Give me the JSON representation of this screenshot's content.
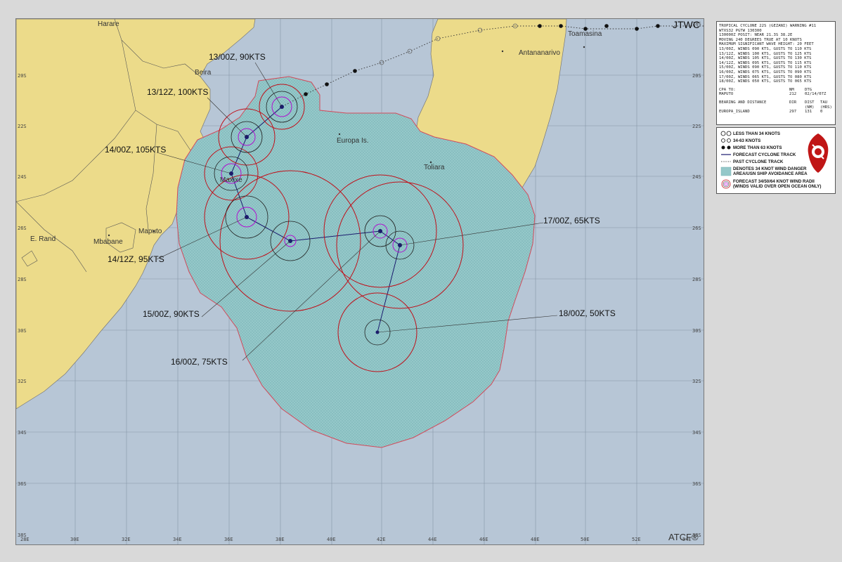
{
  "header": {
    "agency": "JTWC",
    "footer": "ATCF®"
  },
  "axes": {
    "lon_labels": [
      "28E",
      "30E",
      "32E",
      "34E",
      "36E",
      "38E",
      "40E",
      "42E",
      "44E",
      "46E",
      "48E",
      "50E",
      "52E",
      "54E"
    ],
    "lat_labels": [
      "18S",
      "20S",
      "22S",
      "24S",
      "26S",
      "28S",
      "30S",
      "32S",
      "34S",
      "36S",
      "38S"
    ]
  },
  "places": [
    {
      "name": "Harare"
    },
    {
      "name": "Beira"
    },
    {
      "name": "Antananarivo"
    },
    {
      "name": "Toamasina"
    },
    {
      "name": "Europa Is."
    },
    {
      "name": "Toliara"
    },
    {
      "name": "Maxixe"
    },
    {
      "name": "Maputo"
    },
    {
      "name": "Mbabane"
    },
    {
      "name": "E. Rand"
    }
  ],
  "forecast_labels": [
    {
      "text": "13/00Z,  90KTS"
    },
    {
      "text": "13/12Z, 100KTS"
    },
    {
      "text": "14/00Z, 105KTS"
    },
    {
      "text": "14/12Z,  95KTS"
    },
    {
      "text": "15/00Z, 90KTS"
    },
    {
      "text": "16/00Z,  75KTS"
    },
    {
      "text": "17/00Z,  65KTS"
    },
    {
      "text": "18/00Z,  50KTS"
    }
  ],
  "info": {
    "lines": [
      "TROPICAL CYCLONE 22S (GEZANI) WARNING #11",
      "WTXS32 PGTW 130300",
      "130000Z POSIT: NEAR 21.3S 38.2E",
      "MOVING 240 DEGREES TRUE AT 10 KNOTS",
      "MAXIMUM SIGNIFICANT WAVE HEIGHT: 20 FEET",
      "13/00Z, WINDS 090 KTS, GUSTS TO 110 KTS",
      "13/12Z, WINDS 100 KTS, GUSTS TO 125 KTS",
      "14/00Z, WINDS 105 KTS, GUSTS TO 130 KTS",
      "14/12Z, WINDS 095 KTS, GUSTS TO 115 KTS",
      "15/00Z, WINDS 090 KTS, GUSTS TO 110 KTS",
      "16/00Z, WINDS 075 KTS, GUSTS TO 090 KTS",
      "17/00Z, WINDS 065 KTS, GUSTS TO 080 KTS",
      "18/00Z, WINDS 050 KTS, GUSTS TO 065 KTS"
    ],
    "cpa_header": [
      "CPA TO:",
      "NM",
      "DTG"
    ],
    "cpa_row": [
      "MAPUTO",
      "212",
      "02/14/07Z"
    ],
    "bearing_header": [
      "BEARING AND DISTANCE",
      "DIR",
      "DIST",
      "TAU"
    ],
    "bearing_units": [
      "",
      "",
      "(NM)",
      "(HRS)"
    ],
    "bearing_row": [
      "EUROPA_ISLAND",
      "297",
      "131",
      "0"
    ]
  },
  "legend": [
    {
      "label": "LESS THAN 34 KNOTS"
    },
    {
      "label": "34-63 KNOTS"
    },
    {
      "label": "MORE THAN 63 KNOTS"
    },
    {
      "label": "FORECAST CYCLONE TRACK"
    },
    {
      "label": "PAST CYCLONE TRACK"
    },
    {
      "label": "DENOTES 34 KNOT WIND DANGER"
    },
    {
      "label": "AREA/USN SHIP AVOIDANCE AREA"
    },
    {
      "label": "FORECAST 34/50/64 KNOT WIND RADII"
    },
    {
      "label": "(WINDS VALID OVER OPEN OCEAN ONLY)"
    }
  ],
  "colors": {
    "ocean": "#b7c6d6",
    "land": "#ecdb8a",
    "danger_area": "#8fc4c6",
    "radii_34": "#c0101a",
    "radii_50": "#222222",
    "radii_64": "#b010d0",
    "track": "#1a1a6e"
  }
}
